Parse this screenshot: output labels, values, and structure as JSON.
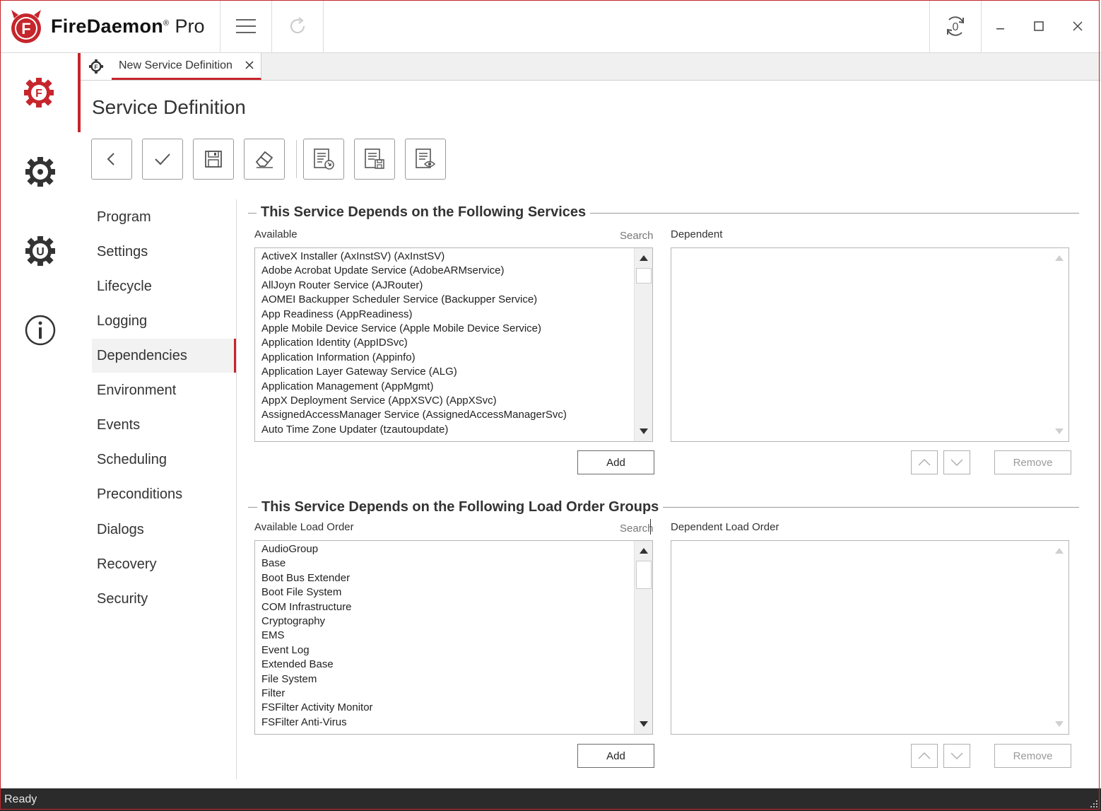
{
  "app": {
    "name": "FireDaemon",
    "edition": "Pro",
    "reg_mark": "®"
  },
  "tab": {
    "label": "New Service Definition"
  },
  "page": {
    "title": "Service Definition"
  },
  "section_nav": {
    "items": [
      "Program",
      "Settings",
      "Lifecycle",
      "Logging",
      "Dependencies",
      "Environment",
      "Events",
      "Scheduling",
      "Preconditions",
      "Dialogs",
      "Recovery",
      "Security"
    ],
    "active": "Dependencies"
  },
  "services_group": {
    "title": "This Service Depends on the Following Services",
    "available_label": "Available",
    "search_label": "Search",
    "dependent_label": "Dependent",
    "available_items": [
      "ActiveX Installer (AxInstSV) (AxInstSV)",
      "Adobe Acrobat Update Service (AdobeARMservice)",
      "AllJoyn Router Service (AJRouter)",
      "AOMEI Backupper Scheduler Service (Backupper Service)",
      "App Readiness (AppReadiness)",
      "Apple Mobile Device Service (Apple Mobile Device Service)",
      "Application Identity (AppIDSvc)",
      "Application Information (Appinfo)",
      "Application Layer Gateway Service (ALG)",
      "Application Management (AppMgmt)",
      "AppX Deployment Service (AppXSVC) (AppXSvc)",
      "AssignedAccessManager Service (AssignedAccessManagerSvc)",
      "Auto Time Zone Updater (tzautoupdate)"
    ],
    "dependent_items": [],
    "add_label": "Add",
    "remove_label": "Remove"
  },
  "load_order_group": {
    "title": "This Service Depends on the Following Load Order Groups",
    "available_label": "Available Load Order",
    "search_label": "Search",
    "dependent_label": "Dependent Load Order",
    "available_items": [
      "AudioGroup",
      "Base",
      "Boot Bus Extender",
      "Boot File System",
      "COM Infrastructure",
      "Cryptography",
      "EMS",
      "Event Log",
      "Extended Base",
      "File System",
      "Filter",
      "FSFilter Activity Monitor",
      "FSFilter Anti-Virus"
    ],
    "dependent_items": [],
    "add_label": "Add",
    "remove_label": "Remove"
  },
  "status": {
    "text": "Ready"
  },
  "colors": {
    "accent": "#c6252c",
    "statusbar": "#2b2b2b"
  },
  "icons": {
    "toolbar": [
      "back-icon",
      "check-icon",
      "save-icon",
      "eraser-icon",
      "export-icon",
      "save-as-icon",
      "preview-icon"
    ],
    "leftnav": [
      "firedaemon-gear-icon",
      "services-gear-icon",
      "update-gear-icon",
      "info-icon"
    ]
  }
}
